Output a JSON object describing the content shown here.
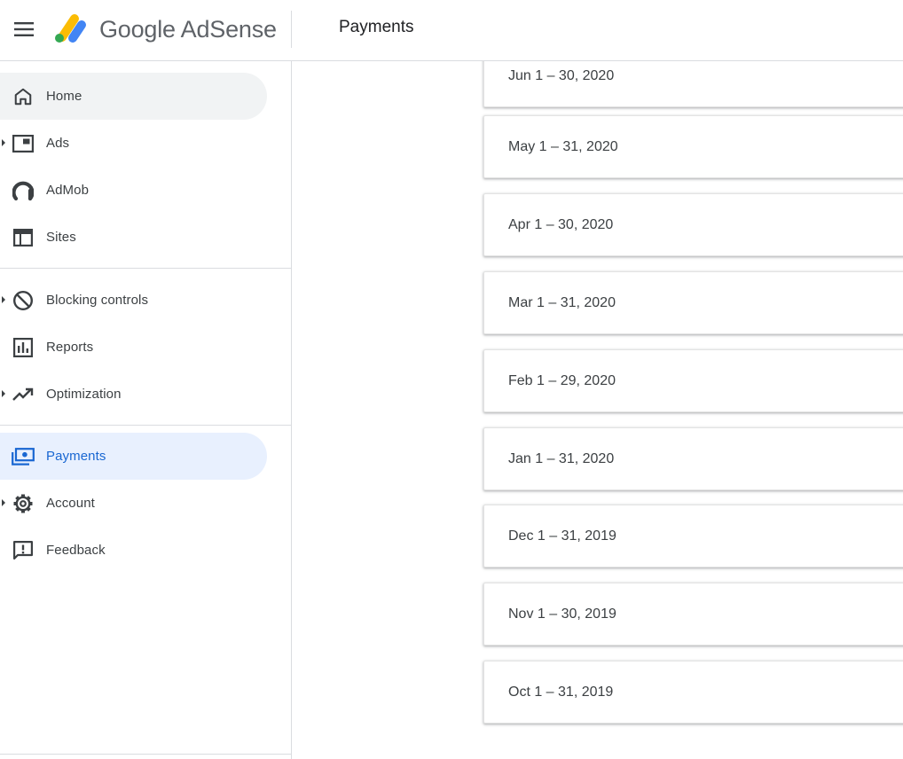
{
  "header": {
    "brand": "Google AdSense",
    "page_title": "Payments"
  },
  "sidebar": {
    "items": [
      {
        "label": "Home",
        "icon": "home-icon",
        "expandable": false,
        "state": "hovered"
      },
      {
        "label": "Ads",
        "icon": "ads-icon",
        "expandable": true,
        "state": ""
      },
      {
        "label": "AdMob",
        "icon": "admob-icon",
        "expandable": false,
        "state": ""
      },
      {
        "label": "Sites",
        "icon": "sites-icon",
        "expandable": false,
        "state": ""
      },
      {
        "label": "Blocking controls",
        "icon": "block-icon",
        "expandable": true,
        "state": ""
      },
      {
        "label": "Reports",
        "icon": "reports-icon",
        "expandable": false,
        "state": ""
      },
      {
        "label": "Optimization",
        "icon": "trending-up-icon",
        "expandable": true,
        "state": ""
      },
      {
        "label": "Payments",
        "icon": "payments-icon",
        "expandable": false,
        "state": "active"
      },
      {
        "label": "Account",
        "icon": "gear-icon",
        "expandable": true,
        "state": ""
      },
      {
        "label": "Feedback",
        "icon": "feedback-icon",
        "expandable": false,
        "state": ""
      }
    ]
  },
  "main": {
    "periods": [
      "Jun 1 – 30, 2020",
      "May 1 – 31, 2020",
      "Apr 1 – 30, 2020",
      "Mar 1 – 31, 2020",
      "Feb 1 – 29, 2020",
      "Jan 1 – 31, 2020",
      "Dec 1 – 31, 2019",
      "Nov 1 – 30, 2019",
      "Oct 1 – 31, 2019"
    ]
  },
  "colors": {
    "accent": "#1967d2",
    "active_bg": "#e8f0fe",
    "hover_bg": "#f1f3f4",
    "divider": "#dadce0",
    "logo_yellow": "#fbbc04",
    "logo_blue": "#4285f4",
    "logo_green": "#34a853"
  }
}
